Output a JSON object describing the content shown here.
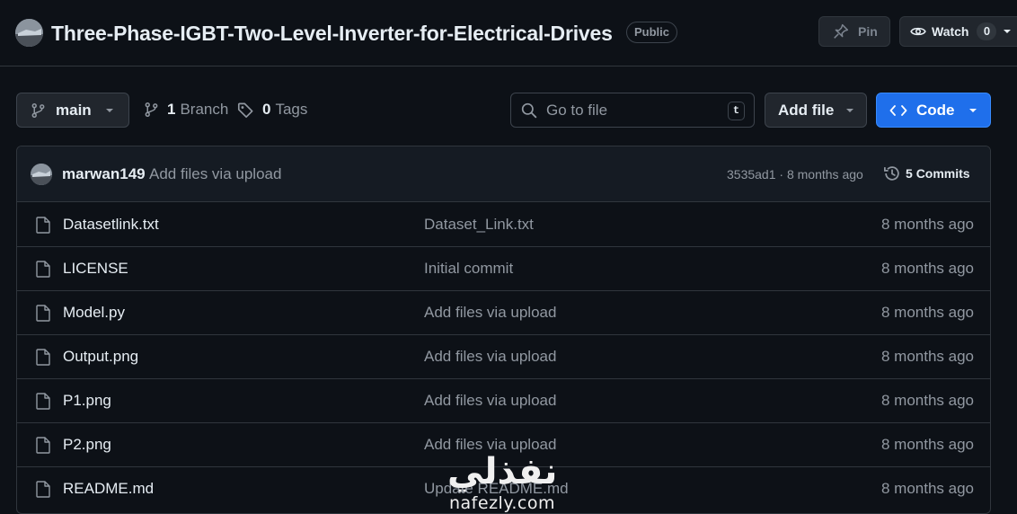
{
  "repo": {
    "name": "Three-Phase-IGBT-Two-Level-Inverter-for-Electrical-Drives",
    "visibility": "Public",
    "pin_label": "Pin",
    "watch_label": "Watch",
    "watch_count": "0"
  },
  "toolbar": {
    "branch": "main",
    "branch_count": "1",
    "branch_label": "Branch",
    "tag_count": "0",
    "tag_label": "Tags",
    "search_placeholder": "Go to file",
    "search_shortcut": "t",
    "add_file_label": "Add file",
    "code_label": "Code"
  },
  "latest_commit": {
    "author": "marwan149",
    "message": "Add files via upload",
    "hash": "3535ad1",
    "separator": "·",
    "age": "8 months ago",
    "commits_count": "5",
    "commits_label": "Commits"
  },
  "files": [
    {
      "name": "Datasetlink.txt",
      "commit": "Dataset_Link.txt",
      "age": "8 months ago"
    },
    {
      "name": "LICENSE",
      "commit": "Initial commit",
      "age": "8 months ago"
    },
    {
      "name": "Model.py",
      "commit": "Add files via upload",
      "age": "8 months ago"
    },
    {
      "name": "Output.png",
      "commit": "Add files via upload",
      "age": "8 months ago"
    },
    {
      "name": "P1.png",
      "commit": "Add files via upload",
      "age": "8 months ago"
    },
    {
      "name": "P2.png",
      "commit": "Add files via upload",
      "age": "8 months ago"
    },
    {
      "name": "README.md",
      "commit": "Update README.md",
      "age": "8 months ago"
    }
  ],
  "watermark": {
    "arabic": "نفذلي",
    "latin": "nafezly.com"
  },
  "colors": {
    "background": "#0d1117",
    "border": "#30363d",
    "header_bg": "#151b23",
    "code_button": "#1f6feb",
    "muted_text": "#9198a1",
    "text": "#e6edf3"
  }
}
